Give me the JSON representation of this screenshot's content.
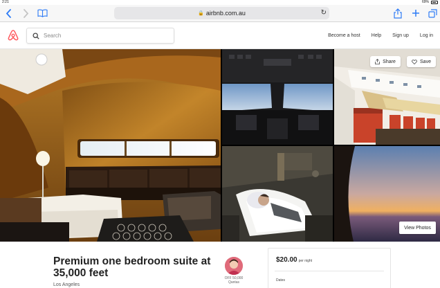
{
  "status_bar": {
    "time": "2:21",
    "battery": "69%"
  },
  "safari": {
    "url": "airbnb.com.au",
    "icons": [
      "back-icon",
      "forward-icon",
      "bookmarks-icon",
      "reload-icon",
      "share-icon",
      "new-tab-icon",
      "tabs-icon"
    ]
  },
  "header": {
    "logo": "airbnb-logo",
    "search_placeholder": "Search",
    "nav": {
      "become_host": "Become a host",
      "help": "Help",
      "sign_up": "Sign up",
      "log_in": "Log in"
    }
  },
  "photos": {
    "share_label": "Share",
    "save_label": "Save",
    "view_photos_label": "View Photos"
  },
  "listing": {
    "title": "Premium one bedroom suite at 35,000 feet",
    "location": "Los Angeles",
    "host_name": "OFF 50,000 Qantas"
  },
  "booking": {
    "price": "$20.00",
    "per_night": "per night",
    "dates_label": "Dates"
  },
  "colors": {
    "airbnb_brand": "#ff5a5f",
    "safari_blue": "#2d7bf6"
  }
}
